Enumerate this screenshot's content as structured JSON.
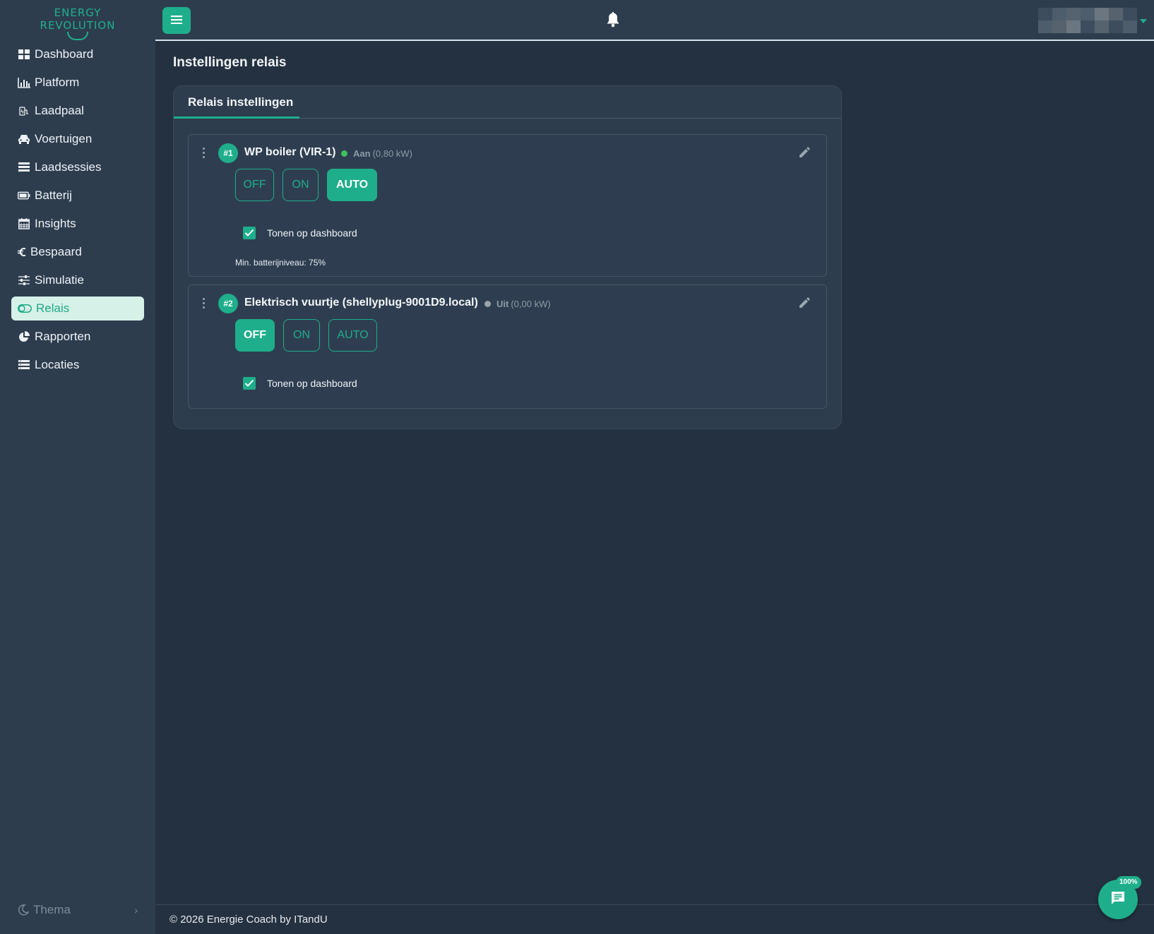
{
  "logo": {
    "line1": "ENERGY",
    "line2": "REVOLUTION"
  },
  "sidebar": {
    "items": [
      {
        "label": "Dashboard",
        "icon": "dashboard-grid-icon"
      },
      {
        "label": "Platform",
        "icon": "bar-chart-icon"
      },
      {
        "label": "Laadpaal",
        "icon": "charging-station-icon"
      },
      {
        "label": "Voertuigen",
        "icon": "car-icon"
      },
      {
        "label": "Laadsessies",
        "icon": "list-icon"
      },
      {
        "label": "Batterij",
        "icon": "battery-icon"
      },
      {
        "label": "Insights",
        "icon": "calendar-icon"
      },
      {
        "label": "Bespaard",
        "icon": "euro-icon"
      },
      {
        "label": "Simulatie",
        "icon": "sliders-icon"
      },
      {
        "label": "Relais",
        "icon": "toggle-icon",
        "active": true
      },
      {
        "label": "Rapporten",
        "icon": "pie-chart-icon"
      },
      {
        "label": "Locaties",
        "icon": "server-icon"
      }
    ],
    "theme_label": "Thema",
    "theme_chevron": "›"
  },
  "page": {
    "title": "Instellingen relais"
  },
  "card": {
    "tab_label": "Relais instellingen"
  },
  "relays": [
    {
      "number": "#1",
      "name": "WP boiler (VIR-1)",
      "status_label": "Aan",
      "status_value": "(0,80 kW)",
      "status_color": "#3fbf5f",
      "modes": [
        "OFF",
        "ON",
        "AUTO"
      ],
      "active_mode": "AUTO",
      "show_on_dashboard_label": "Tonen op dashboard",
      "min_battery_label": "Min. batterijniveau: 75%"
    },
    {
      "number": "#2",
      "name": "Elektrisch vuurtje (shellyplug-9001D9.local)",
      "status_label": "Uit",
      "status_value": "(0,00 kW)",
      "status_color": "#9aa3ac",
      "modes": [
        "OFF",
        "ON",
        "AUTO"
      ],
      "active_mode": "OFF",
      "show_on_dashboard_label": "Tonen op dashboard"
    }
  ],
  "footer": {
    "text": "© 2026 Energie Coach by ITandU"
  },
  "chat": {
    "badge": "100%"
  },
  "colors": {
    "accent": "#1fae8b",
    "background": "#243140",
    "panel": "#2d3d4e"
  }
}
